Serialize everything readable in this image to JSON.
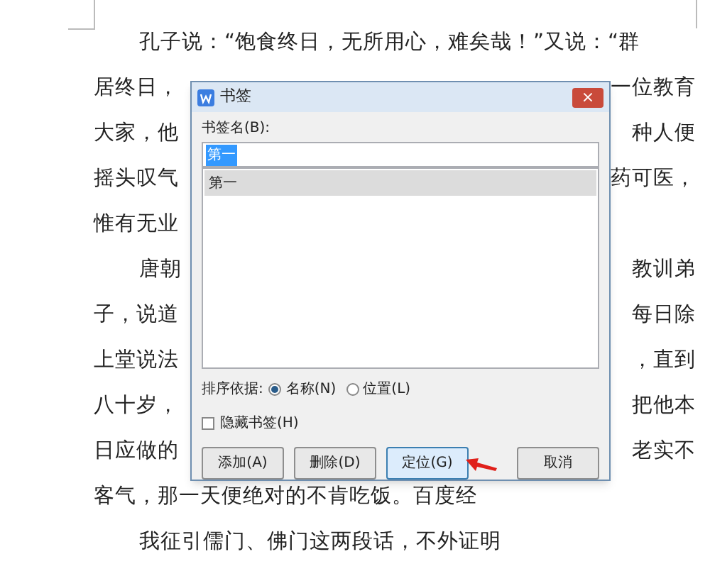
{
  "document": {
    "lines": [
      {
        "indent": true,
        "left": "孔子说：“饱食终日，无所用心，难矣哉！”又说：“群"
      },
      {
        "indent": false,
        "left": "居终日，",
        "right": "一位教育"
      },
      {
        "indent": false,
        "left": "大家，他",
        "right": "种人便"
      },
      {
        "indent": false,
        "left": "摇头叹气",
        "right": "药可医，"
      },
      {
        "indent": false,
        "left": "惟有无业"
      },
      {
        "indent": true,
        "left": "唐朝",
        "right": "教训弟"
      },
      {
        "indent": false,
        "left": "子，说道",
        "right": "每日除"
      },
      {
        "indent": false,
        "left": "上堂说法",
        "right": "，直到"
      },
      {
        "indent": false,
        "left": "八十岁，",
        "right": "把他本"
      },
      {
        "indent": false,
        "left": "日应做的",
        "right": "老实不"
      },
      {
        "indent": false,
        "left": "客气，那一天便绝对的不肯吃饭。百度经"
      },
      {
        "indent": true,
        "left": "我征引儒门、佛门这两段话，不外证明"
      }
    ]
  },
  "dialog": {
    "title": "书签",
    "close": "×",
    "name_label": "书签名(B):",
    "name_value": "第一",
    "list": [
      {
        "label": "第一",
        "selected": true
      }
    ],
    "sort_label": "排序依据:",
    "sort_options": [
      {
        "label": "名称(N)",
        "selected": true
      },
      {
        "label": "位置(L)",
        "selected": false
      }
    ],
    "hide_checkbox": {
      "label": "隐藏书签(H)",
      "checked": false
    },
    "buttons": [
      {
        "label": "添加(A)",
        "focused": false
      },
      {
        "label": "删除(D)",
        "focused": false
      },
      {
        "label": "定位(G)",
        "focused": true
      },
      {
        "label": "取消",
        "focused": false
      }
    ]
  }
}
